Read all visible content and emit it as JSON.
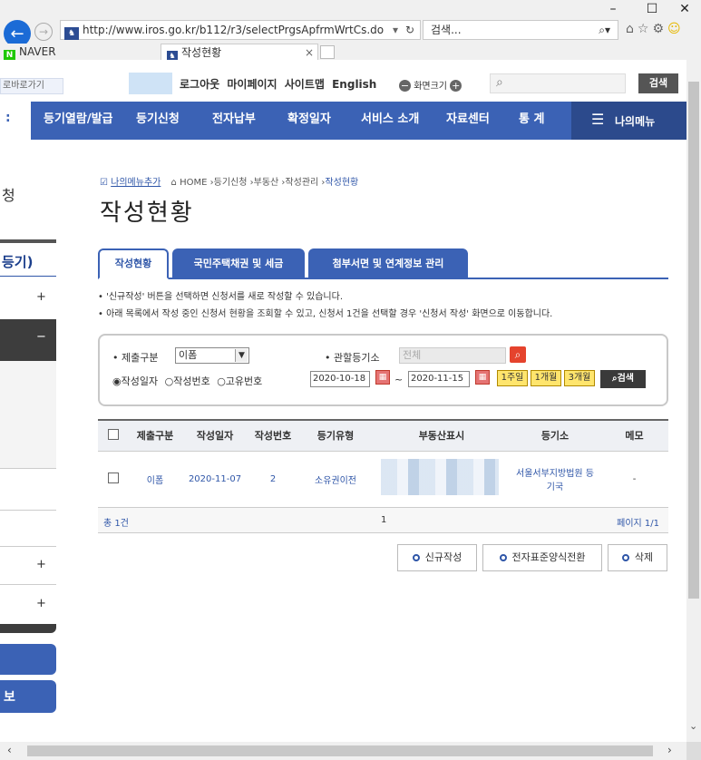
{
  "browser": {
    "url": "http://www.iros.go.kr/b112/r3/selectPrgsApfrmWrtCs.do",
    "search_placeholder": "검색...",
    "tabs": [
      {
        "label": "NAVER"
      },
      {
        "label": "작성현황"
      }
    ],
    "tab_close": "×"
  },
  "header": {
    "quick_link": "로그아웃 마이페이지 사이트맵 English",
    "logout": "로그아웃",
    "mypage": "마이페이지",
    "sitemap": "사이트맵",
    "english": "English",
    "font_size": "화면크기",
    "search_button": "검색",
    "left_crop": "로바로가기"
  },
  "gnb": {
    "items": [
      "등기열람/발급",
      "등기신청",
      "전자납부",
      "확정일자",
      "서비스 소개",
      "자료센터",
      "통 계"
    ],
    "my_menu": "나의메뉴"
  },
  "sidebar": {
    "head_crop": "등기)",
    "title_crop": "청",
    "bottom_crop": "보",
    "plus": "+",
    "minus": "−"
  },
  "breadcrumb": {
    "my_menu_add": "나의메뉴추가",
    "path": [
      "HOME",
      "등기신청",
      "부동산",
      "작성관리",
      "작성현황"
    ]
  },
  "page_title": "작성현황",
  "tabs": [
    {
      "label": "작성현황"
    },
    {
      "label": "국민주택채권 및 세금"
    },
    {
      "label": "첨부서면 및 연계정보 관리"
    }
  ],
  "notes": [
    "• '신규작성' 버튼을 선택하면 신청서를 새로 작성할 수 있습니다.",
    "• 아래 목록에서 작성 중인 신청서 현황을 조회할 수 있고, 신청서 1건을 선택할 경우 '신청서 작성' 화면으로 이동합니다."
  ],
  "filter": {
    "submit_type_label": "• 제출구분",
    "submit_type_value": "이폼",
    "registry_label": "• 관할등기소",
    "registry_placeholder": "전체",
    "radio_options": [
      "작성일자",
      "작성번호",
      "고유번호"
    ],
    "date_from": "2020-10-18",
    "date_to": "2020-11-15",
    "tilde": "~",
    "periods": [
      "1주일",
      "1개월",
      "3개월"
    ],
    "search": "검색"
  },
  "table": {
    "headers": [
      "제출구분",
      "작성일자",
      "작성번호",
      "등기유형",
      "부동산표시",
      "등기소",
      "메모"
    ],
    "rows": [
      {
        "submit_type": "이폼",
        "date": "2020-11-07",
        "number": "2",
        "type": "소유권이전",
        "registry": "서울서부지방법원 등기국",
        "memo": "-"
      }
    ],
    "total": "총 1건",
    "pager_current": "1",
    "page_info": "페이지 1/1"
  },
  "actions": {
    "new": "신규작성",
    "convert": "전자표준양식전환",
    "delete": "삭제"
  },
  "colors": {
    "gnb": "#3b62b5",
    "accent": "#2f56a8",
    "highlight_btn": "#ffe56d",
    "search_red": "#e5432d",
    "dark_btn": "#3a3a3a"
  }
}
